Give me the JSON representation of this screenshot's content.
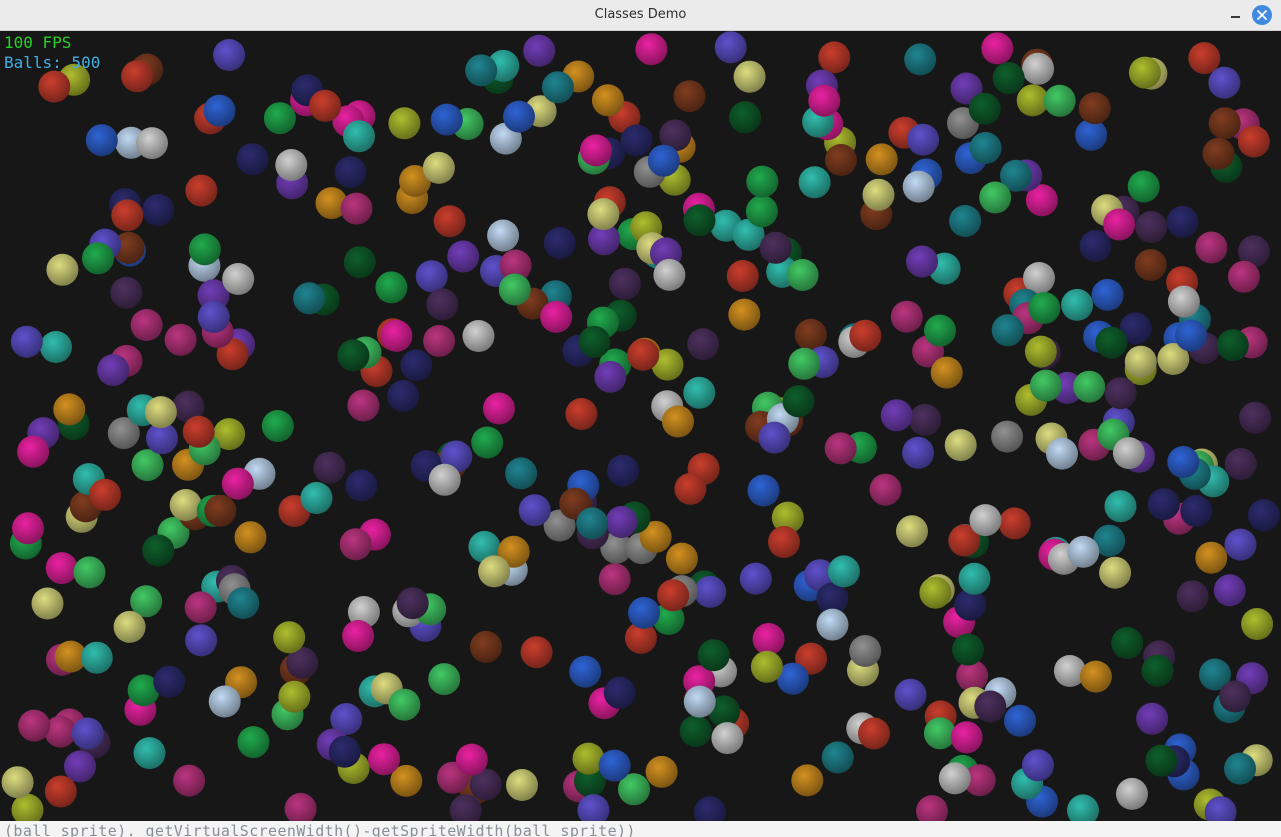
{
  "window": {
    "title": "Classes Demo",
    "minimize_icon": "minimize-icon",
    "close_icon": "close-icon"
  },
  "hud": {
    "fps_text": "100 FPS",
    "balls_text": "Balls: 500"
  },
  "editor_behind": {
    "code_line": "(ball sprite). getVirtualScreenWidth()-getSpriteWidth(ball sprite))"
  },
  "scene": {
    "background_color": "#171717",
    "ball_count": 500,
    "ball_colors": [
      "#1fa34a",
      "#c13b2b",
      "#2fb5a6",
      "#6d3bb0",
      "#c98a1e",
      "#a6b52c",
      "#2d5fcc",
      "#b3327a",
      "#3fc060",
      "#8a8a8a",
      "#5a4ec4",
      "#d2d27a",
      "#1e7f8a",
      "#7a3a1e",
      "#b8d0e8",
      "#4a2f5a",
      "#c7c7c7",
      "#0e5a2a",
      "#e0209a",
      "#2a2a6a"
    ]
  },
  "colors": {
    "titlebar_bg": "#ebebeb",
    "close_button": "#3f8ae0",
    "fps_color": "#26d126",
    "balls_color": "#3eb0e6"
  }
}
